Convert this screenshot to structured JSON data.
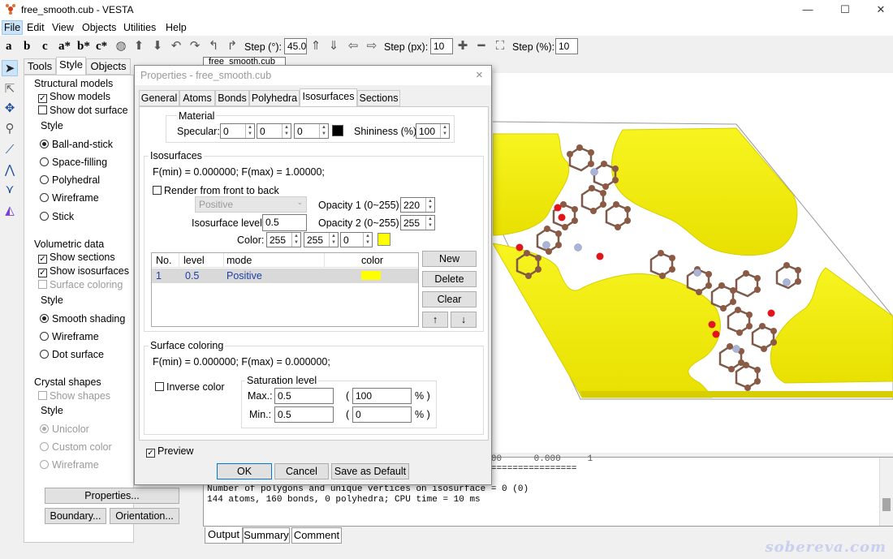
{
  "window": {
    "title": "free_smooth.cub - VESTA",
    "minimize": "—",
    "maximize": "☐",
    "close": "✕"
  },
  "menu": [
    "File",
    "Edit",
    "View",
    "Objects",
    "Utilities",
    "Help"
  ],
  "toolbar": {
    "letters": [
      "a",
      "b",
      "c",
      "a*",
      "b*",
      "c*"
    ],
    "step_deg_label": "Step (°):",
    "step_deg_value": "45.0",
    "step_px_label": "Step (px):",
    "step_px_value": "10",
    "step_pct_label": "Step (%):",
    "step_pct_value": "10",
    "tooltip": "free_smooth.cub"
  },
  "left_panel": {
    "tabs": [
      "Tools",
      "Style",
      "Objects"
    ],
    "structural": {
      "title": "Structural models",
      "show_models": "Show models",
      "show_dot_surface": "Show dot surface",
      "style_label": "Style",
      "styles": [
        "Ball-and-stick",
        "Space-filling",
        "Polyhedral",
        "Wireframe",
        "Stick"
      ]
    },
    "volumetric": {
      "title": "Volumetric data",
      "show_sections": "Show sections",
      "show_isosurfaces": "Show isosurfaces",
      "surface_coloring": "Surface coloring",
      "style_label": "Style",
      "styles": [
        "Smooth shading",
        "Wireframe",
        "Dot surface"
      ]
    },
    "crystal": {
      "title": "Crystal shapes",
      "show_shapes": "Show shapes",
      "style_label": "Style",
      "styles": [
        "Unicolor",
        "Custom color",
        "Wireframe"
      ]
    },
    "properties_btn": "Properties...",
    "boundary_btn": "Boundary...",
    "orientation_btn": "Orientation..."
  },
  "dialog": {
    "title": "Properties - free_smooth.cub",
    "close": "×",
    "tabs": [
      "General",
      "Atoms",
      "Bonds",
      "Polyhedra",
      "Isosurfaces",
      "Sections"
    ],
    "material": {
      "title": "Material",
      "specular_label": "Specular:",
      "specular": [
        "0",
        "0",
        "0"
      ],
      "shininess_label": "Shininess (%):",
      "shininess": "100"
    },
    "isosurfaces": {
      "title": "Isosurfaces",
      "fminmax": "F(min) = 0.000000;   F(max) = 1.00000;",
      "render_front_back": "Render from front to back",
      "mode_select": "Positive",
      "opacity1_label": "Opacity 1 (0~255):",
      "opacity1": "220",
      "opacity2_label": "Opacity 2 (0~255):",
      "opacity2": "255",
      "level_label": "Isosurface level:",
      "level": "0.5",
      "color_label": "Color:",
      "color": [
        "255",
        "255",
        "0"
      ],
      "swatch": "#ffff00",
      "table_headers": [
        "No.",
        "level",
        "mode",
        "color"
      ],
      "rows": [
        {
          "no": "1",
          "level": "0.5",
          "mode": "Positive"
        }
      ],
      "new_btn": "New",
      "delete_btn": "Delete",
      "clear_btn": "Clear",
      "up_btn": "↑",
      "down_btn": "↓"
    },
    "surface_coloring": {
      "title": "Surface coloring",
      "fminmax": "F(min) = 0.000000;   F(max) = 0.000000;",
      "inverse": "Inverse color",
      "sat_title": "Saturation level",
      "max_label": "Max.:",
      "max": "0.5",
      "max_pct": "100",
      "min_label": "Min.:",
      "min": "0.5",
      "min_pct": "0",
      "open_paren": "(",
      "pct_close": "% )"
    },
    "preview": "Preview",
    "ok": "OK",
    "cancel": "Cancel",
    "save_default": "Save as Default"
  },
  "output": {
    "lines": [
      "                                                  1.000      0.000     1",
      "=====================================================================",
      "Number of polygons and unique vertices on isosurface = 0 (0)",
      "144 atoms, 160 bonds, 0 polyhedra; CPU time = 10 ms"
    ],
    "tabs": [
      "Output",
      "Summary",
      "Comment"
    ]
  },
  "watermark": "sobereva.com",
  "colors": {
    "isosurface": "#f4f000",
    "carbon": "#8b5a44",
    "oxygen": "#e0141a",
    "nitrogen": "#a9b4d6"
  }
}
